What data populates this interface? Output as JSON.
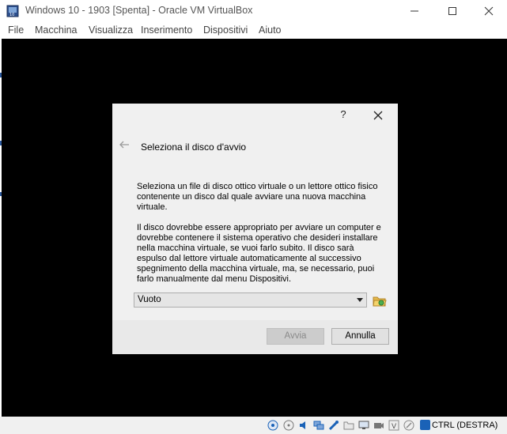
{
  "window": {
    "title": "Windows 10 - 1903 [Spenta] - Oracle VM VirtualBox"
  },
  "menu": {
    "items": [
      "File",
      "Macchina",
      "Visualizza",
      "Inserimento",
      "Dispositivi",
      "Aiuto"
    ]
  },
  "dialog": {
    "help_label": "?",
    "heading": "Seleziona il disco d'avvio",
    "paragraph1": "Seleziona un file di disco ottico virtuale o un lettore ottico fisico contenente un disco dal quale avviare una nuova macchina virtuale.",
    "paragraph2": "Il disco dovrebbe essere appropriato per avviare un computer e dovrebbe contenere il sistema operativo che desideri installare nella macchina virtuale, se vuoi farlo subito. Il disco sarà espulso dal lettore virtuale automaticamente al successivo spegnimento della macchina virtuale, ma, se necessario, puoi farlo manualmente dal menu Dispositivi.",
    "disk_select_value": "Vuoto",
    "start_button": "Avvia",
    "cancel_button": "Annulla"
  },
  "statusbar": {
    "host_key": "CTRL (DESTRA)",
    "icons": [
      "hard-disk-icon",
      "optical-drive-icon",
      "audio-icon",
      "network-icon",
      "usb-icon",
      "shared-folders-icon",
      "display-icon",
      "video-capture-icon",
      "mouse-integration-icon",
      "virtualization-icon",
      "host-key-icon"
    ]
  },
  "colors": {
    "vm_background": "#000000",
    "dialog_background": "#f0f0f0",
    "accent": "#1a62b7"
  }
}
